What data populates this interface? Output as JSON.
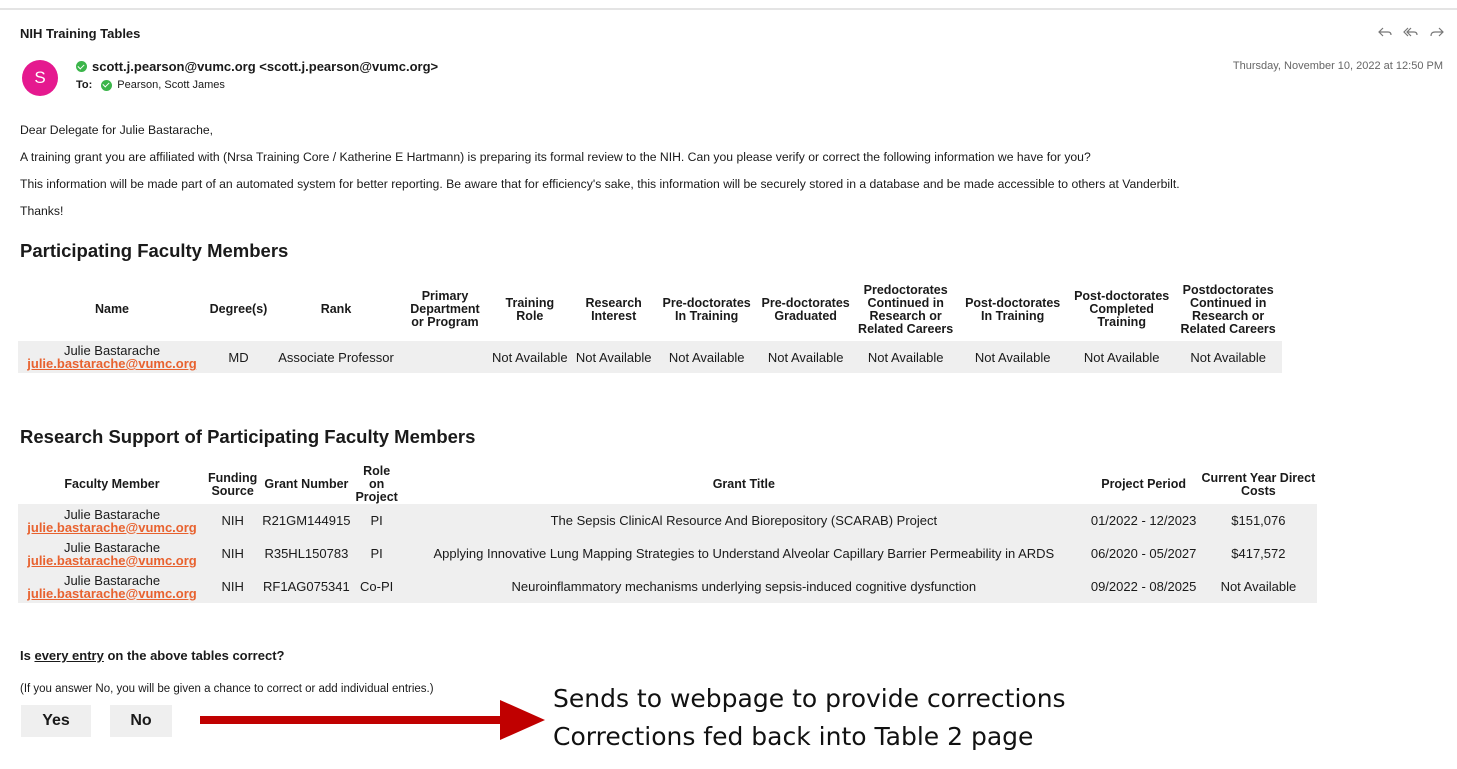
{
  "email": {
    "subject": "NIH Training Tables",
    "avatar_letter": "S",
    "from": "scott.j.pearson@vumc.org <scott.j.pearson@vumc.org>",
    "to_label": "To:",
    "to": "Pearson, Scott James",
    "date": "Thursday, November 10, 2022 at 12:50 PM",
    "toolbar": [
      "reply-icon",
      "reply-all-icon",
      "forward-icon"
    ]
  },
  "body": {
    "greeting": "Dear Delegate for Julie Bastarache,",
    "para1": "A training grant you are affiliated with (Nrsa Training Core / Katherine E Hartmann) is preparing its formal review to the NIH. Can you please verify or correct the following information we have for you?",
    "para2": "This information will be made part of an automated system for better reporting. Be aware that for efficiency's sake, this information will be securely stored in a database and be made accessible to others at Vanderbilt.",
    "thanks": "Thanks!"
  },
  "faculty_table": {
    "heading": "Participating Faculty Members",
    "headers": [
      "Name",
      "Degree(s)",
      "Rank",
      "Primary Department or Program",
      "Training Role",
      "Research Interest",
      "Pre-doctorates In Training",
      "Pre-doctorates Graduated",
      "Predoctorates Continued in Research or Related Careers",
      "Post-doctorates In Training",
      "Post-doctorates Completed Training",
      "Postdoctorates Continued in Research or Related Careers"
    ],
    "row": {
      "name": "Julie Bastarache",
      "email": "julie.bastarache@vumc.org",
      "degree": "MD",
      "rank": "Associate Professor",
      "department": "",
      "training_role": "Not Available",
      "research_interest": "Not Available",
      "predoc_training": "Not Available",
      "predoc_graduated": "Not Available",
      "predoc_continued": "Not Available",
      "postdoc_training": "Not Available",
      "postdoc_completed": "Not Available",
      "postdoc_continued": "Not Available"
    }
  },
  "support_table": {
    "heading": "Research Support of Participating Faculty Members",
    "headers": [
      "Faculty Member",
      "Funding Source",
      "Grant Number",
      "Role on Project",
      "Grant Title",
      "Project Period",
      "Current Year Direct Costs"
    ],
    "rows": [
      {
        "name": "Julie Bastarache",
        "email": "julie.bastarache@vumc.org",
        "source": "NIH",
        "grant": "R21GM144915",
        "role": "PI",
        "title": "The Sepsis ClinicAl Resource And Biorepository (SCARAB) Project",
        "period": "01/2022 - 12/2023",
        "costs": "$151,076"
      },
      {
        "name": "Julie Bastarache",
        "email": "julie.bastarache@vumc.org",
        "source": "NIH",
        "grant": "R35HL150783",
        "role": "PI",
        "title": "Applying Innovative Lung Mapping Strategies to Understand Alveolar Capillary Barrier Permeability in ARDS",
        "period": "06/2020 - 05/2027",
        "costs": "$417,572"
      },
      {
        "name": "Julie Bastarache",
        "email": "julie.bastarache@vumc.org",
        "source": "NIH",
        "grant": "RF1AG075341",
        "role": "Co-PI",
        "title": "Neuroinflammatory mechanisms underlying sepsis-induced cognitive dysfunction",
        "period": "09/2022 - 08/2025",
        "costs": "Not Available"
      }
    ]
  },
  "confirm": {
    "question_prefix": "Is ",
    "question_underlined": "every entry",
    "question_suffix": " on the above tables correct?",
    "note": "(If you answer No, you will be given a chance to correct or add individual entries.)",
    "yes": "Yes",
    "no": "No"
  },
  "annotation": {
    "line1": "Sends to webpage to provide corrections",
    "line2": "Corrections fed back into Table 2 page",
    "arrow_color": "#c00000"
  }
}
